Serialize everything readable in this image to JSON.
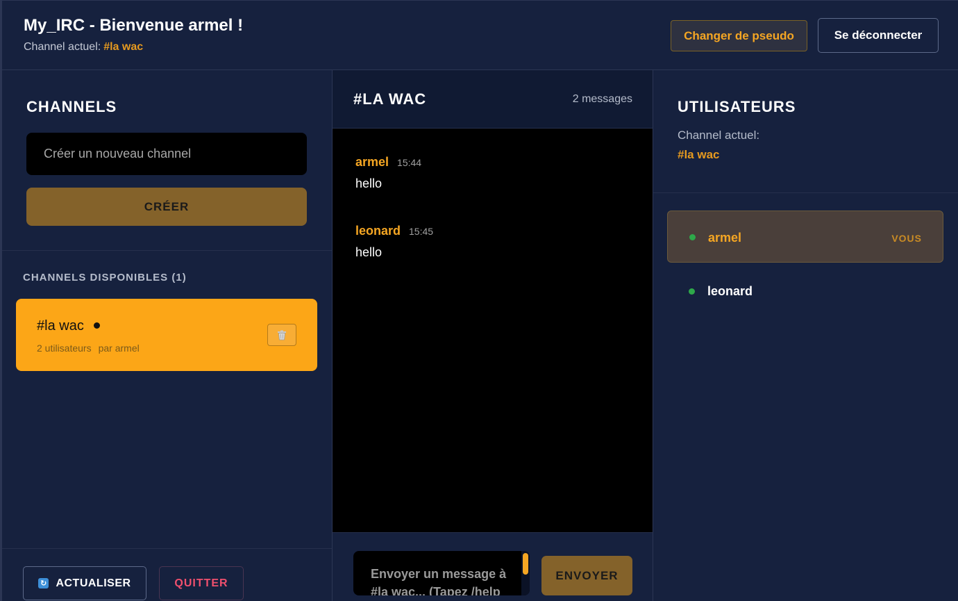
{
  "header": {
    "title": "My_IRC - Bienvenue armel !",
    "channel_label": "Channel actuel:",
    "channel_name": "#la wac",
    "change_nick_label": "Changer de pseudo",
    "logout_label": "Se déconnecter"
  },
  "sidebar": {
    "title": "CHANNELS",
    "new_channel_placeholder": "Créer un nouveau channel",
    "create_label": "CRÉER",
    "available_title": "CHANNELS DISPONIBLES (1)",
    "channels": [
      {
        "name": "#la wac",
        "users": "2 utilisateurs",
        "owner": "par armel"
      }
    ],
    "refresh_label": "ACTUALISER",
    "quit_label": "QUITTER"
  },
  "chat": {
    "title": "#LA WAC",
    "message_count": "2 messages",
    "messages": [
      {
        "author": "armel",
        "time": "15:44",
        "text": "hello"
      },
      {
        "author": "leonard",
        "time": "15:45",
        "text": "hello"
      }
    ],
    "input_placeholder": "Envoyer un message à #la wac... (Tapez /help",
    "send_label": "ENVOYER"
  },
  "users": {
    "title": "UTILISATEURS",
    "channel_label": "Channel actuel:",
    "channel_name": "#la wac",
    "list": [
      {
        "name": "armel",
        "badge": "VOUS"
      },
      {
        "name": "leonard"
      }
    ]
  },
  "colors": {
    "background": "#16213e",
    "accent": "#f5a623",
    "online": "#2ea84a",
    "danger": "#f0506e"
  },
  "icons": {
    "delete": "trash-icon",
    "refresh": "refresh-icon",
    "online": "online-status-icon"
  }
}
